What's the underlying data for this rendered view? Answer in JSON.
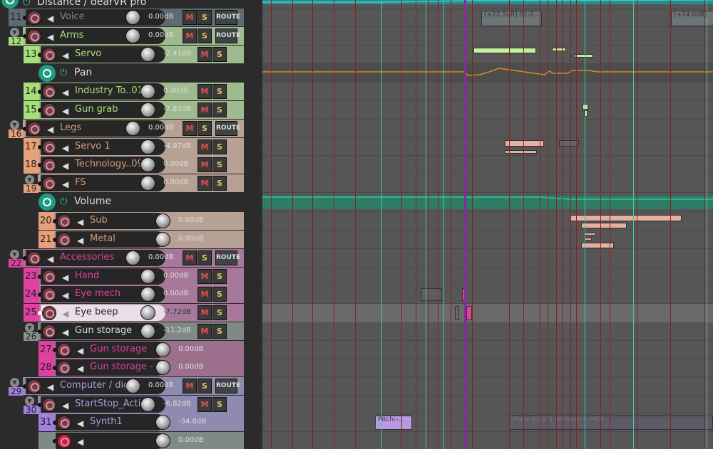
{
  "header_track": {
    "name": "Distance / dearVR pro"
  },
  "labels": {
    "mute": "M",
    "solo": "S",
    "route": "ROUTE"
  },
  "envelopes": [
    {
      "name": "Pan",
      "color": "#e08a1e"
    },
    {
      "name": "Volume",
      "color": "#2ec79a"
    }
  ],
  "tracks": [
    {
      "num": "11",
      "name": "Voice",
      "vol": "0.00dB",
      "ms": true,
      "route": true,
      "folder": false,
      "indent": 0,
      "color": "#5f6b72",
      "bg": "#5f6b72",
      "text": "#7d8a90"
    },
    {
      "num": "12",
      "name": "Arms",
      "vol": "0.00dB",
      "ms": true,
      "route": true,
      "folder": true,
      "indent": 0,
      "color": "#a6e07a",
      "bg": "#9fba8e",
      "text": "#a6e07a"
    },
    {
      "num": "13",
      "name": "Servo",
      "vol": "-2.41dB",
      "ms": true,
      "route": false,
      "folder": false,
      "indent": 1,
      "color": "#a6e07a",
      "bg": "#9fba8e",
      "text": "#a6e07a"
    },
    {
      "num": "14",
      "name": "Industry To..01",
      "vol": "0.00dB",
      "ms": true,
      "route": false,
      "folder": false,
      "indent": 1,
      "color": "#a6e07a",
      "bg": "#9fba8e",
      "text": "#a6e07a"
    },
    {
      "num": "15",
      "name": "Gun grab",
      "vol": "-7.83dB",
      "ms": true,
      "route": false,
      "folder": false,
      "indent": 1,
      "color": "#a6e07a",
      "bg": "#9fba8e",
      "text": "#a6e07a"
    },
    {
      "num": "16",
      "name": "Legs",
      "vol": "0.00dB",
      "ms": true,
      "route": true,
      "folder": true,
      "indent": 0,
      "color": "#e6a07a",
      "bg": "#b7a194",
      "text": "#d49a7c"
    },
    {
      "num": "17",
      "name": "Servo 1",
      "vol": "-4.97dB",
      "ms": true,
      "route": false,
      "folder": false,
      "indent": 1,
      "color": "#e6a07a",
      "bg": "#b7a194",
      "text": "#d49a7c"
    },
    {
      "num": "18",
      "name": "Technology..09",
      "vol": "0.00dB",
      "ms": true,
      "route": false,
      "folder": false,
      "indent": 1,
      "color": "#e6a07a",
      "bg": "#b7a194",
      "text": "#d49a7c"
    },
    {
      "num": "19",
      "name": "FS",
      "vol": "0.00dB",
      "ms": true,
      "route": false,
      "folder": true,
      "indent": 1,
      "color": "#e6a07a",
      "bg": "#b7a194",
      "text": "#d49a7c"
    },
    {
      "num": "20",
      "name": "Sub",
      "vol": "0.00dB",
      "ms": false,
      "route": false,
      "folder": false,
      "indent": 2,
      "color": "#e6a07a",
      "bg": "#b7a194",
      "text": "#d49a7c"
    },
    {
      "num": "21",
      "name": "Metal",
      "vol": "0.00dB",
      "ms": false,
      "route": false,
      "folder": false,
      "indent": 2,
      "color": "#e6a07a",
      "bg": "#b7a194",
      "text": "#d49a7c"
    },
    {
      "num": "22",
      "name": "Accessories",
      "vol": "0.00dB",
      "ms": true,
      "route": true,
      "folder": true,
      "indent": 0,
      "color": "#e040a0",
      "bg": "#a7789a",
      "text": "#e040a0"
    },
    {
      "num": "23",
      "name": "Hand",
      "vol": "0.00dB",
      "ms": true,
      "route": false,
      "folder": false,
      "indent": 1,
      "color": "#e040a0",
      "bg": "#a7789a",
      "text": "#e040a0"
    },
    {
      "num": "24",
      "name": "Eye mech",
      "vol": "0.00dB",
      "ms": true,
      "route": false,
      "folder": false,
      "indent": 1,
      "color": "#e040a0",
      "bg": "#a7789a",
      "text": "#e040a0"
    },
    {
      "num": "25",
      "name": "Eye beep",
      "vol": "-7.72dB",
      "ms": true,
      "route": false,
      "folder": false,
      "indent": 1,
      "color": "#e040a0",
      "bg": "#a7789a",
      "text": "#222",
      "selected": true
    },
    {
      "num": "26",
      "name": "Gun storage",
      "vol": "-11.2dB",
      "ms": true,
      "route": false,
      "folder": true,
      "indent": 1,
      "color": "#8a948f",
      "bg": "#7f8a85",
      "text": "#ddd"
    },
    {
      "num": "27",
      "name": "Gun storage",
      "vol": "0.00dB",
      "ms": false,
      "route": false,
      "folder": false,
      "indent": 2,
      "color": "#e040a0",
      "bg": "#9c6f8c",
      "text": "#e040a0"
    },
    {
      "num": "28",
      "name": "Gun storage - c",
      "vol": "0.00dB",
      "ms": false,
      "route": false,
      "folder": false,
      "indent": 2,
      "color": "#e040a0",
      "bg": "#9c6f8c",
      "text": "#e040a0"
    },
    {
      "num": "29",
      "name": "Computer / dig",
      "vol": "0.00dB",
      "ms": true,
      "route": true,
      "folder": true,
      "indent": 0,
      "color": "#a080e0",
      "bg": "#8f8ab0",
      "text": "#a89cd8"
    },
    {
      "num": "30",
      "name": "StartStop_Activ",
      "vol": "-6.82dB",
      "ms": true,
      "route": false,
      "folder": true,
      "indent": 1,
      "color": "#a080e0",
      "bg": "#8f8ab0",
      "text": "#a89cd8"
    },
    {
      "num": "31",
      "name": "Synth1",
      "vol": "-34.8dB",
      "ms": false,
      "route": false,
      "folder": false,
      "indent": 2,
      "color": "#a080e0",
      "bg": "#8f8ab0",
      "text": "#a89cd8"
    },
    {
      "num": "",
      "name": "",
      "vol": "0.00dB",
      "ms": false,
      "route": false,
      "folder": false,
      "indent": 2,
      "color": "#7f8a85",
      "bg": "#7f8a85",
      "text": "#ddd",
      "armed": true
    }
  ],
  "items": [
    {
      "label": "[+22.5dB] 01-2...",
      "row": "11"
    },
    {
      "label": "[+24.0dB]",
      "row": "11"
    },
    {
      "label": "Pitch:-...",
      "row": "31"
    },
    {
      "label": "[Rate:0.227] 30-Synth1-MIDI",
      "row": "31"
    }
  ]
}
